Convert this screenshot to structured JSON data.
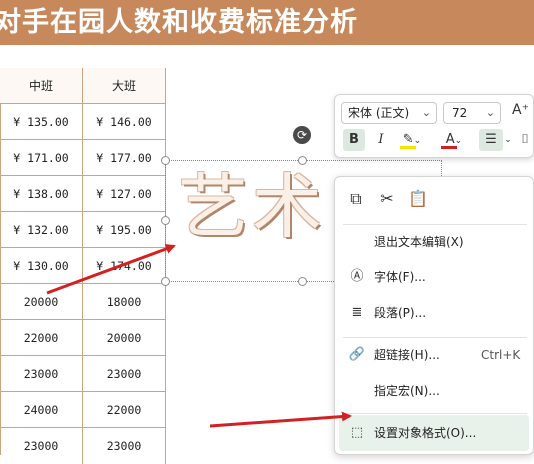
{
  "banner": {
    "title": "对手在园人数和收费标准分析"
  },
  "sheet": {
    "headers": [
      "中班",
      "大班"
    ],
    "rows": [
      [
        "¥ 135.00",
        "¥ 146.00"
      ],
      [
        "¥ 171.00",
        "¥ 177.00"
      ],
      [
        "¥ 138.00",
        "¥ 127.00"
      ],
      [
        "¥ 132.00",
        "¥ 195.00"
      ],
      [
        "¥ 130.00",
        "¥ 174.00"
      ],
      [
        "20000",
        "18000"
      ],
      [
        "22000",
        "20000"
      ],
      [
        "23000",
        "23000"
      ],
      [
        "24000",
        "22000"
      ],
      [
        "23000",
        "23000"
      ]
    ]
  },
  "art_text": {
    "text": "艺术"
  },
  "toolbar": {
    "font_name": "宋体 (正文)",
    "font_size": "72",
    "grow_icon": "A⁺",
    "bold": "B",
    "italic": "I",
    "highlight_color": "#f2e600",
    "font_color": "#d02020",
    "font_color_letter": "A"
  },
  "menu": {
    "items": [
      {
        "label": "退出文本编辑(X)",
        "shortcut": ""
      },
      {
        "label": "字体(F)...",
        "shortcut": ""
      },
      {
        "label": "段落(P)...",
        "shortcut": ""
      },
      {
        "label": "超链接(H)...",
        "shortcut": "Ctrl+K"
      },
      {
        "label": "指定宏(N)...",
        "shortcut": ""
      },
      {
        "label": "设置对象格式(O)...",
        "shortcut": ""
      }
    ]
  },
  "colors": {
    "banner": "#c7895b",
    "arrow": "#d32020",
    "highlight": "#e9f1eb"
  }
}
